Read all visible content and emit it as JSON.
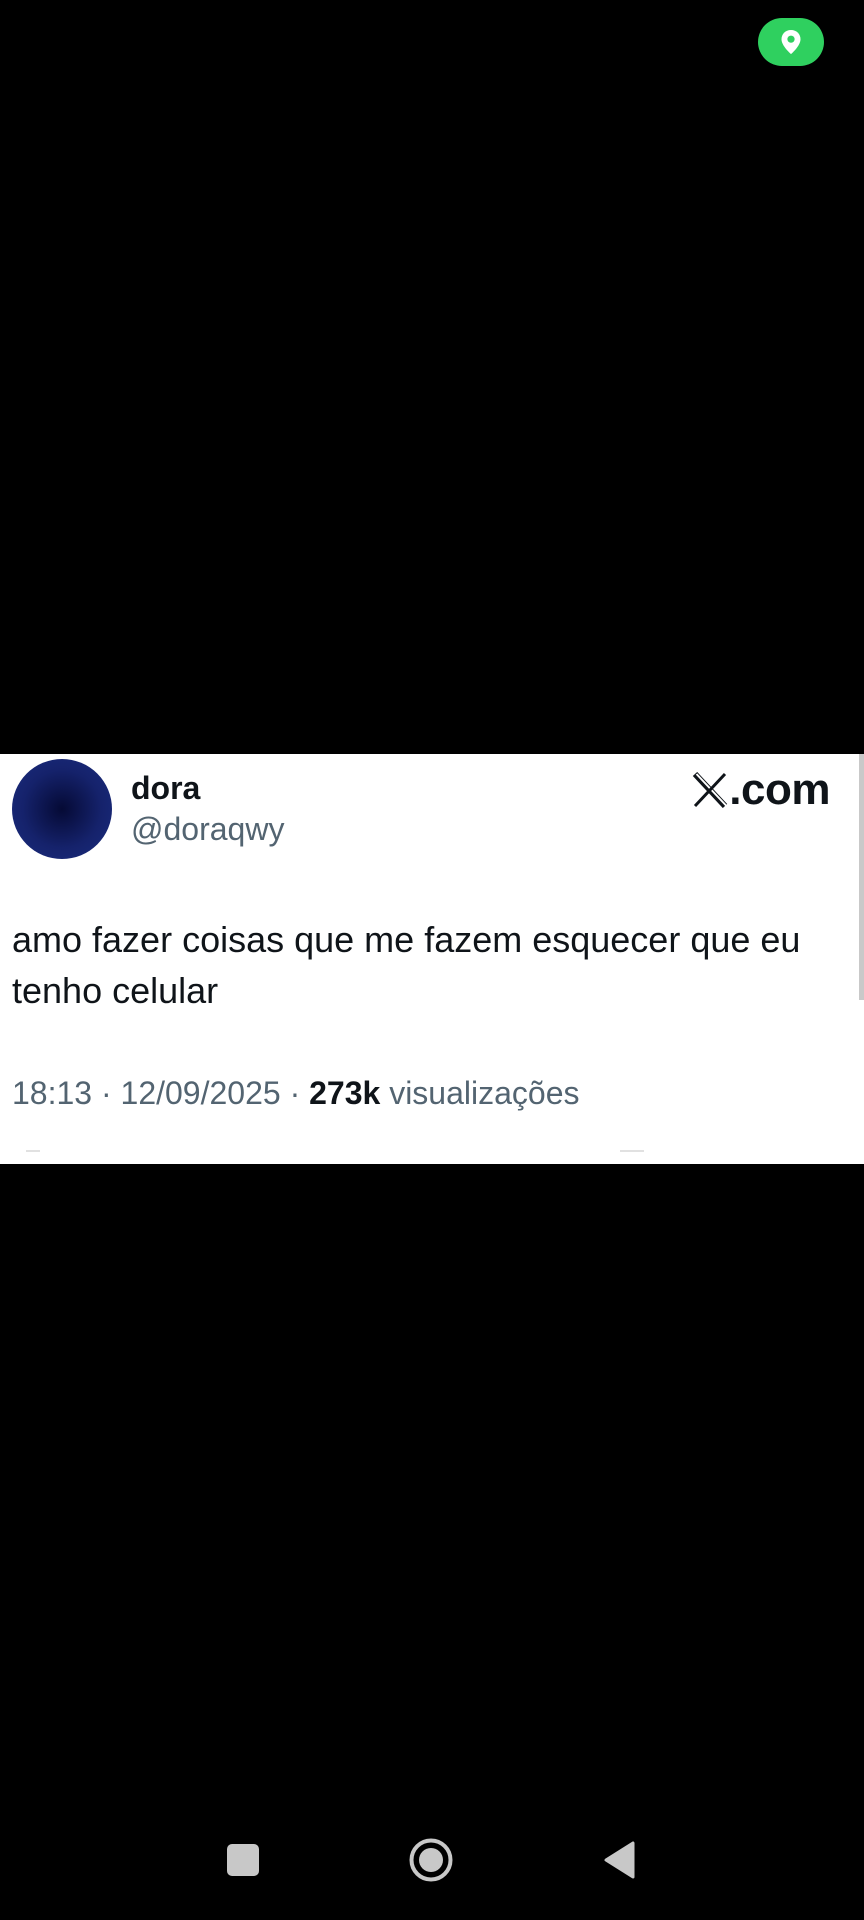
{
  "status_bar": {
    "location_icon": "location-pin-icon",
    "location_color": "#2fd05f"
  },
  "tweet": {
    "display_name": "dora",
    "handle": "@doraqwy",
    "brand_suffix": ".com",
    "brand_icon": "x-logo-icon",
    "text": "amo fazer coisas que me fazem esquecer que eu tenho celular",
    "time": "18:13",
    "separator": "·",
    "date": "12/09/2025",
    "views_count": "273k",
    "views_label": "visualizações"
  },
  "nav_bar": {
    "recents_icon": "square-icon",
    "home_icon": "circle-icon",
    "back_icon": "triangle-back-icon"
  },
  "colors": {
    "background": "#000000",
    "card": "#ffffff",
    "primary_text": "#0f1419",
    "secondary_text": "#536471",
    "avatar": "#1b2d80"
  }
}
